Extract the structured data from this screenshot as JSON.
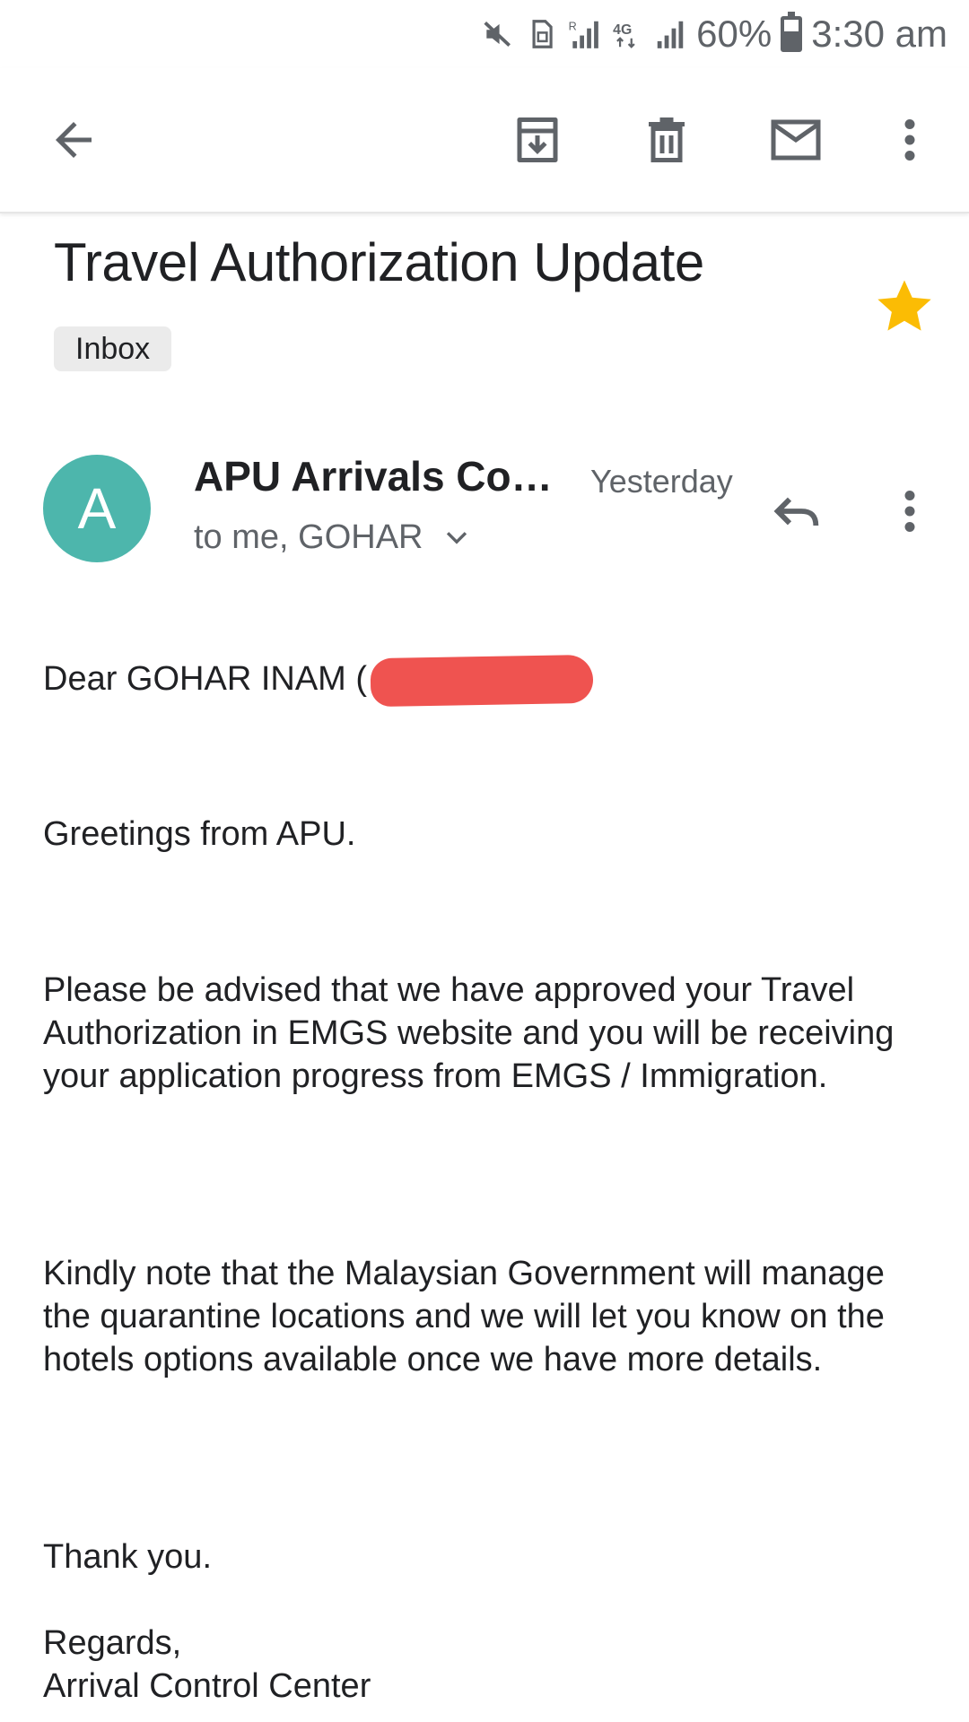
{
  "status_bar": {
    "battery_percent": "60%",
    "battery_level": 0.6,
    "time": "3:30 am",
    "icons": [
      "mute-icon",
      "sim-icon",
      "signal-roaming-icon",
      "4g-icon",
      "signal-icon",
      "battery-icon"
    ]
  },
  "toolbar": {
    "icons": [
      "back-arrow-icon",
      "archive-icon",
      "delete-icon",
      "mark-unread-icon",
      "more-vert-icon"
    ]
  },
  "email": {
    "subject": "Travel Authorization Update",
    "label": "Inbox",
    "starred": true,
    "star_color": "#fbbc04"
  },
  "sender": {
    "avatar_letter": "A",
    "avatar_color": "#4db6ac",
    "name": "APU Arrivals Control Center",
    "time": "Yesterday",
    "recipients": "to me, GOHAR"
  },
  "body": {
    "salutation": "Dear GOHAR INAM (",
    "greeting": "Greetings from APU.",
    "paragraph1": "Please be advised that we have approved your Travel Authorization in EMGS website and you will be receiving your application progress from EMGS / Immigration.",
    "paragraph2": "Kindly note that the Malaysian Government will manage the quarantine locations and we will let you know on the hotels options available once we have more details.",
    "thanks": "Thank you.",
    "regards": "Regards,",
    "signature": "Arrival Control Center"
  }
}
